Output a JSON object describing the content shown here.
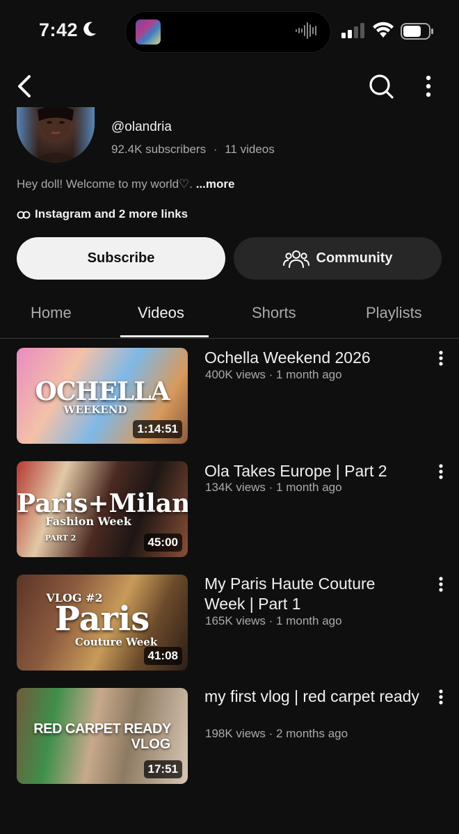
{
  "status_bar": {
    "time": "7:42"
  },
  "channel": {
    "handle": "@olandria",
    "subscribers": "92.4K subscribers",
    "separator": "·",
    "video_count": "11 videos",
    "bio": "Hey doll! Welcome to my world♡.",
    "bio_more": "...more",
    "links": "Instagram and 2 more links"
  },
  "actions": {
    "subscribe": "Subscribe",
    "community": "Community"
  },
  "tabs": [
    {
      "label": "Home"
    },
    {
      "label": "Videos"
    },
    {
      "label": "Shorts"
    },
    {
      "label": "Playlists"
    }
  ],
  "videos": [
    {
      "title": "Ochella Weekend 2026",
      "meta": "400K views · 1 month ago",
      "duration": "1:14:51",
      "thumb_text": "OCHELLA",
      "thumb_sub": "WEEKEND"
    },
    {
      "title": "Ola Takes Europe | Part 2",
      "meta": "134K views · 1 month ago",
      "duration": "45:00",
      "thumb_text": "Paris+Milan",
      "thumb_sub": "Fashion Week",
      "thumb_tag": "PART 2"
    },
    {
      "title": "My Paris Haute Couture Week | Part 1",
      "meta": "165K views · 1 month ago",
      "duration": "41:08",
      "thumb_text": "Paris",
      "thumb_sub": "Couture Week",
      "thumb_tag": "VLOG #2"
    },
    {
      "title": "my first vlog | red carpet ready",
      "meta": "198K views · 2 months ago",
      "duration": "17:51",
      "thumb_text": "RED CARPET READY",
      "thumb_sub": "VLOG"
    }
  ],
  "colors": {
    "background": "#0f0f0f",
    "text": "#f1f1f1",
    "secondary": "#aaaaaa",
    "chip": "#272727"
  }
}
